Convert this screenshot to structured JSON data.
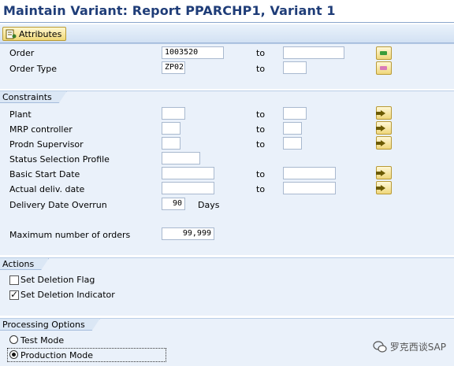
{
  "title": "Maintain Variant: Report PPARCHP1, Variant 1",
  "toolbar": {
    "attributes_label": "Attributes"
  },
  "selection": {
    "to_label": "to",
    "rows": [
      {
        "label": "Order",
        "from": "1003520",
        "to": ""
      },
      {
        "label": "Order Type",
        "from": "ZP02",
        "to": ""
      }
    ]
  },
  "constraints": {
    "tab": "Constraints",
    "to_label": "to",
    "plant": {
      "label": "Plant",
      "from": "",
      "to": ""
    },
    "mrp": {
      "label": "MRP controller",
      "from": "",
      "to": ""
    },
    "prodn": {
      "label": "Prodn Supervisor",
      "from": "",
      "to": ""
    },
    "status_profile": {
      "label": "Status Selection Profile",
      "value": ""
    },
    "basic_start": {
      "label": "Basic Start Date",
      "from": "",
      "to": ""
    },
    "actual_deliv": {
      "label": "Actual deliv. date",
      "from": "",
      "to": ""
    },
    "overrun": {
      "label": "Delivery Date Overrun",
      "value": "90",
      "unit": "Days"
    },
    "max_orders": {
      "label": "Maximum number of orders",
      "value": "99,999"
    }
  },
  "actions": {
    "tab": "Actions",
    "set_deletion_flag": {
      "label": "Set Deletion Flag",
      "checked": false
    },
    "set_deletion_indicator": {
      "label": "Set Deletion Indicator",
      "checked": true
    }
  },
  "processing": {
    "tab": "Processing Options",
    "test_mode": {
      "label": "Test Mode",
      "selected": false
    },
    "production_mode": {
      "label": "Production Mode",
      "selected": true
    }
  },
  "watermark": {
    "text": "罗克西谈SAP",
    "icon": "wechat-icon"
  },
  "colors": {
    "title": "#1f3d78",
    "panel": "#eaf1fa",
    "toolbar": "#d2e1f3",
    "button": "#efd77a"
  }
}
